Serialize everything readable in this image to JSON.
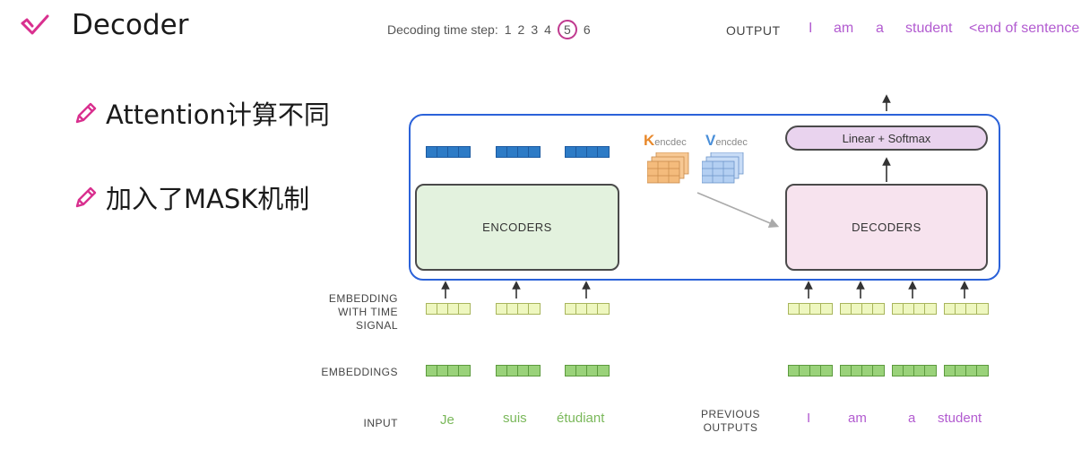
{
  "slide": {
    "title": "Decoder",
    "bullets": [
      {
        "text": "Attention计算不同"
      },
      {
        "text": "加入了MASK机制"
      }
    ]
  },
  "diagram": {
    "decoding_label": "Decoding time step:",
    "steps": [
      "1",
      "2",
      "3",
      "4",
      "5",
      "6"
    ],
    "active_step": "5",
    "output_label": "OUTPUT",
    "output_words": [
      "I",
      "am",
      "a",
      "student",
      "<end of sentence"
    ],
    "k_letter": "K",
    "k_sub": "encdec",
    "v_letter": "V",
    "v_sub": "encdec",
    "linear_softmax": "Linear + Softmax",
    "encoders": "ENCODERS",
    "decoders": "DECODERS",
    "embedding_time_label": [
      "EMBEDDING",
      "WITH TIME",
      "SIGNAL"
    ],
    "embeddings_label": "EMBEDDINGS",
    "input_label": "INPUT",
    "input_words": [
      "Je",
      "suis",
      "étudiant"
    ],
    "previous_outputs_label": [
      "PREVIOUS",
      "OUTPUTS"
    ],
    "previous_words": [
      "I",
      "am",
      "a",
      "student"
    ]
  },
  "colors": {
    "frame": "#2b62d9",
    "encoder_fill": "#e3f2de",
    "decoder_fill": "#f7e3ee",
    "output_text": "#b25bd0",
    "input_text": "#7ab85a",
    "active_step_ring": "#c03a8f"
  }
}
